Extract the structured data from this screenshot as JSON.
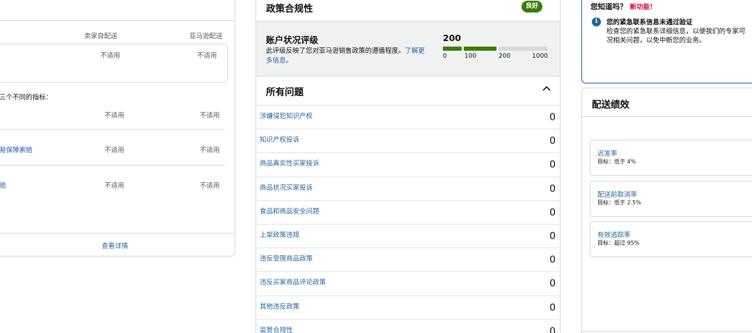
{
  "left_card": {
    "col_seller": "卖家自配送",
    "col_amazon": "亚马逊配送",
    "top_row": {
      "seller": "不适用",
      "amazon": "不适用"
    },
    "note": "三个不同的指标：",
    "rows": [
      {
        "label": "",
        "seller": "不适用",
        "amazon": "不适用"
      },
      {
        "label": "易保障索赔",
        "seller": "不适用",
        "amazon": "不适用"
      },
      {
        "label": "赔",
        "seller": "不适用",
        "amazon": "不适用"
      }
    ],
    "detail_link": "查看详情"
  },
  "policy": {
    "title": "政策合规性",
    "badge": "良好",
    "ahr": {
      "title": "账户状况评级",
      "desc": "此评级反映了您对亚马逊销售政策的遵循程度。",
      "link": "了解更多信息。",
      "score": "200",
      "score_fraction": 0.2,
      "ticks": [
        "0",
        "100",
        "200",
        "1000"
      ],
      "colors": {
        "good": "#3a7d0a",
        "empty": "#d5d9d9"
      }
    },
    "issues_title": "所有问题",
    "issues": [
      {
        "label": "涉嫌侵犯知识产权",
        "count": "0"
      },
      {
        "label": "知识产权投诉",
        "count": "0"
      },
      {
        "label": "商品真实性买家投诉",
        "count": "0"
      },
      {
        "label": "商品状况买家投诉",
        "count": "0"
      },
      {
        "label": "食品和商品安全问题",
        "count": "0"
      },
      {
        "label": "上架政策违规",
        "count": "0"
      },
      {
        "label": "违反受限商品政策",
        "count": "0"
      },
      {
        "label": "违反买家商品评论政策",
        "count": "0"
      },
      {
        "label": "其他违反政策",
        "count": "0"
      },
      {
        "label": "监管合规性",
        "count": "0"
      }
    ]
  },
  "did_you_know": {
    "heading": "您知道吗？",
    "new_label": "新功能！",
    "bold": "您的紧急联系信息未通过验证",
    "line1": "检查您的紧急联系详细信息，以便我们的专家可",
    "line2": "况相关问题，以免中断您的业务。"
  },
  "shipping": {
    "title": "配送绩效",
    "metrics": [
      {
        "name": "迟发率",
        "target": "目标：低于 4%"
      },
      {
        "name": "配送前取消率",
        "target": "目标：低于 2.5%"
      },
      {
        "name": "有效追踪率",
        "target": "目标：超过 95%"
      }
    ]
  }
}
